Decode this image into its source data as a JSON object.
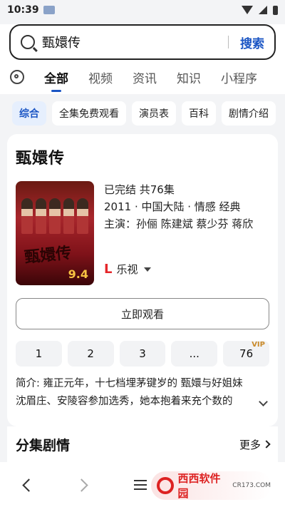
{
  "status": {
    "time": "10:39"
  },
  "search": {
    "query": "甄嬛传",
    "button": "搜索"
  },
  "tabs": [
    "全部",
    "视频",
    "资讯",
    "知识",
    "小程序"
  ],
  "chips": [
    "综合",
    "全集免费观看",
    "演员表",
    "百科",
    "剧情介绍"
  ],
  "card": {
    "title": "甄嬛传",
    "poster_text": "甄嬛传",
    "score": "9.4",
    "status": "已完结 共76集",
    "year_region_genre": "2011 · 中国大陆 · 情感 经典",
    "cast": "主演：孙俪 陈建斌 蔡少芬 蒋欣",
    "provider_icon": "L",
    "provider": "乐视",
    "watch_button": "立即观看",
    "episodes": [
      "1",
      "2",
      "3",
      "...",
      "76"
    ],
    "vip_label": "VIP",
    "summary": "简介: 雍正元年，十七档埋茅键岁的 甄嬛与好姐妹沈眉庄、安陵容参加选秀，她本抱着来充个数的"
  },
  "section": {
    "title": "分集剧情",
    "more": "更多"
  },
  "watermark": {
    "text": "西西软件园",
    "sub": "CR173.COM"
  }
}
